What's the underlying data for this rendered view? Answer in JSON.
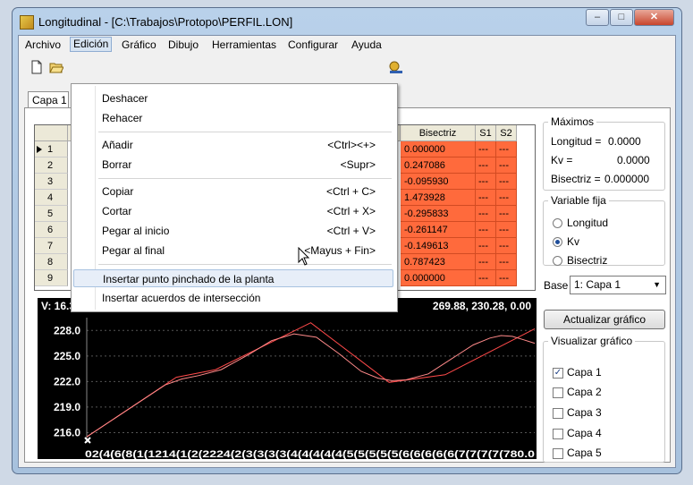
{
  "window": {
    "title": "Longitudinal - [C:\\Trabajos\\Protopo\\PERFIL.LON]",
    "min": "–",
    "max": "□",
    "close": "✕"
  },
  "menubar": [
    "Archivo",
    "Edición",
    "Gráfico",
    "Dibujo",
    "Herramientas",
    "Configurar",
    "Ayuda"
  ],
  "tabs": {
    "active": "Capa 1"
  },
  "grid": {
    "headers": [
      "Bisectriz",
      "S1",
      "S2"
    ],
    "rows": [
      {
        "n": "1",
        "bis": "0.000000",
        "s1": "---",
        "s2": "---"
      },
      {
        "n": "2",
        "bis": "0.247086",
        "s1": "---",
        "s2": "---"
      },
      {
        "n": "3",
        "bis": "-0.095930",
        "s1": "---",
        "s2": "---"
      },
      {
        "n": "4",
        "bis": "1.473928",
        "s1": "---",
        "s2": "---"
      },
      {
        "n": "5",
        "bis": "-0.295833",
        "s1": "---",
        "s2": "---"
      },
      {
        "n": "6",
        "bis": "-0.261147",
        "s1": "---",
        "s2": "---"
      },
      {
        "n": "7",
        "bis": "-0.149613",
        "s1": "---",
        "s2": "---"
      },
      {
        "n": "8",
        "bis": "0.787423",
        "s1": "---",
        "s2": "---"
      },
      {
        "n": "9",
        "bis": "0.000000",
        "s1": "---",
        "s2": "---"
      }
    ]
  },
  "dropdown": {
    "items": [
      {
        "label": "Deshacer",
        "shortcut": ""
      },
      {
        "label": "Rehacer",
        "shortcut": ""
      },
      {
        "label": "Añadir",
        "shortcut": "<Ctrl><+>"
      },
      {
        "label": "Borrar",
        "shortcut": "<Supr>"
      },
      {
        "label": "Copiar",
        "shortcut": "<Ctrl + C>"
      },
      {
        "label": "Cortar",
        "shortcut": "<Ctrl + X>"
      },
      {
        "label": "Pegar al inicio",
        "shortcut": "<Ctrl + V>"
      },
      {
        "label": "Pegar al final",
        "shortcut": "<Mayus + Fin>"
      },
      {
        "label": "Insertar punto pinchado de la planta",
        "shortcut": ""
      },
      {
        "label": "Insertar acuerdos de intersección",
        "shortcut": ""
      }
    ]
  },
  "maximos": {
    "title": "Máximos",
    "longitud_label": "Longitud =",
    "longitud": "0.0000",
    "kv_label": "Kv =",
    "kv": "0.0000",
    "bisectriz_label": "Bisectriz =",
    "bisectriz": "0.000000"
  },
  "variable_fija": {
    "title": "Variable fija",
    "options": [
      "Longitud",
      "Kv",
      "Bisectriz"
    ],
    "selected": "Kv"
  },
  "base": {
    "label": "Base",
    "value": "1: Capa 1"
  },
  "actualizar_label": "Actualizar gráfico",
  "visualizar": {
    "title": "Visualizar gráfico",
    "layers": [
      {
        "label": "Capa 1",
        "checked": true
      },
      {
        "label": "Capa 2",
        "checked": false
      },
      {
        "label": "Capa 3",
        "checked": false
      },
      {
        "label": "Capa 4",
        "checked": false
      },
      {
        "label": "Capa 5",
        "checked": false
      }
    ]
  },
  "chart_data": {
    "type": "line",
    "header_left": "V: 16.3",
    "header_right": "269.88,  230.28, 0.00",
    "yticks": [
      "228.0",
      "225.0",
      "222.0",
      "219.0",
      "216.0"
    ],
    "ylim": [
      215.0,
      229.5
    ],
    "xlim": [
      0,
      800
    ],
    "x_tick_text": "02(4(6(8(1(1214(1(2(2224(2(3(3(3(3(4(4(4(4(4(5(5(5(5(5(6(6(6(6(6(7(7(7(7(780.0",
    "series": [
      {
        "color": "#ff4a4a",
        "x": [
          0,
          160,
          230,
          400,
          540,
          640,
          800
        ],
        "y": [
          215.5,
          222.5,
          223.4,
          228.9,
          221.9,
          222.8,
          228.2
        ]
      },
      {
        "color": "#ff8a8a",
        "x": [
          0,
          140,
          170,
          200,
          240,
          290,
          330,
          370,
          410,
          450,
          490,
          520,
          545,
          570,
          610,
          650,
          690,
          720,
          740,
          760,
          780,
          800
        ],
        "y": [
          215.5,
          221.6,
          222.3,
          222.7,
          223.4,
          225.2,
          226.8,
          227.6,
          227.2,
          225.3,
          223.2,
          222.4,
          222.1,
          222.2,
          222.9,
          224.6,
          226.3,
          227.1,
          227.4,
          227.3,
          226.9,
          226.5
        ]
      }
    ]
  }
}
